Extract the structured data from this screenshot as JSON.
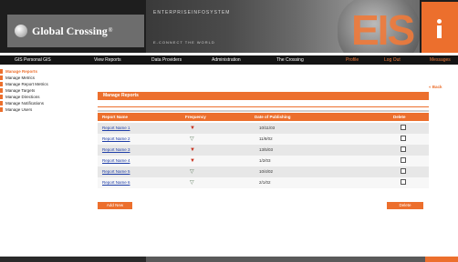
{
  "header": {
    "logo_text": "Global Crossing",
    "logo_tm": "®",
    "banner_text": "ENTERPRISEINFOSYSTEM",
    "banner_subtext": "E-CONNECT THE WORLD",
    "eis_text": "EIS",
    "info_icon": "info-icon"
  },
  "nav": {
    "items": [
      {
        "label": "GIS Personal GIS"
      },
      {
        "label": "View Reports"
      },
      {
        "label": "Data Providers"
      },
      {
        "label": "Administration"
      },
      {
        "label": "The Crossing"
      },
      {
        "label": "Profile"
      },
      {
        "label": "Log Out"
      },
      {
        "label": "Messages"
      }
    ]
  },
  "sidebar": {
    "items": [
      {
        "label": "Manage Reports"
      },
      {
        "label": "Manage Metrics"
      },
      {
        "label": "Manage Report Metrics"
      },
      {
        "label": "Manage Targets"
      },
      {
        "label": "Manage Directions"
      },
      {
        "label": "Manage Notifications"
      },
      {
        "label": "Manage Users"
      }
    ]
  },
  "main": {
    "back_label": "« Back",
    "panel_title": "Manage Reports",
    "columns": {
      "name": "Report Name",
      "frequency": "Frequency",
      "date": "Date of Publishing",
      "delete": "Delete"
    },
    "rows": [
      {
        "name": "Report Name 1",
        "frequency": "▼",
        "freq_color": "#c8311e",
        "date": "10/11/03"
      },
      {
        "name": "Report Name 2",
        "frequency": "▽",
        "freq_color": "#5a7a5a",
        "date": "11/8/02"
      },
      {
        "name": "Report Name 3",
        "frequency": "▼",
        "freq_color": "#c8311e",
        "date": "13/5/03"
      },
      {
        "name": "Report Name 4",
        "frequency": "▼",
        "freq_color": "#c8311e",
        "date": "1/2/03"
      },
      {
        "name": "Report Name 5",
        "frequency": "▽",
        "freq_color": "#5a7a5a",
        "date": "10/4/02"
      },
      {
        "name": "Report Name 6",
        "frequency": "▽",
        "freq_color": "#5a7a5a",
        "date": "2/1/02"
      }
    ],
    "add_button": "Add New",
    "delete_button": "Delete"
  },
  "colors": {
    "accent": "#ec6f2d",
    "link": "#1f3ea8"
  }
}
